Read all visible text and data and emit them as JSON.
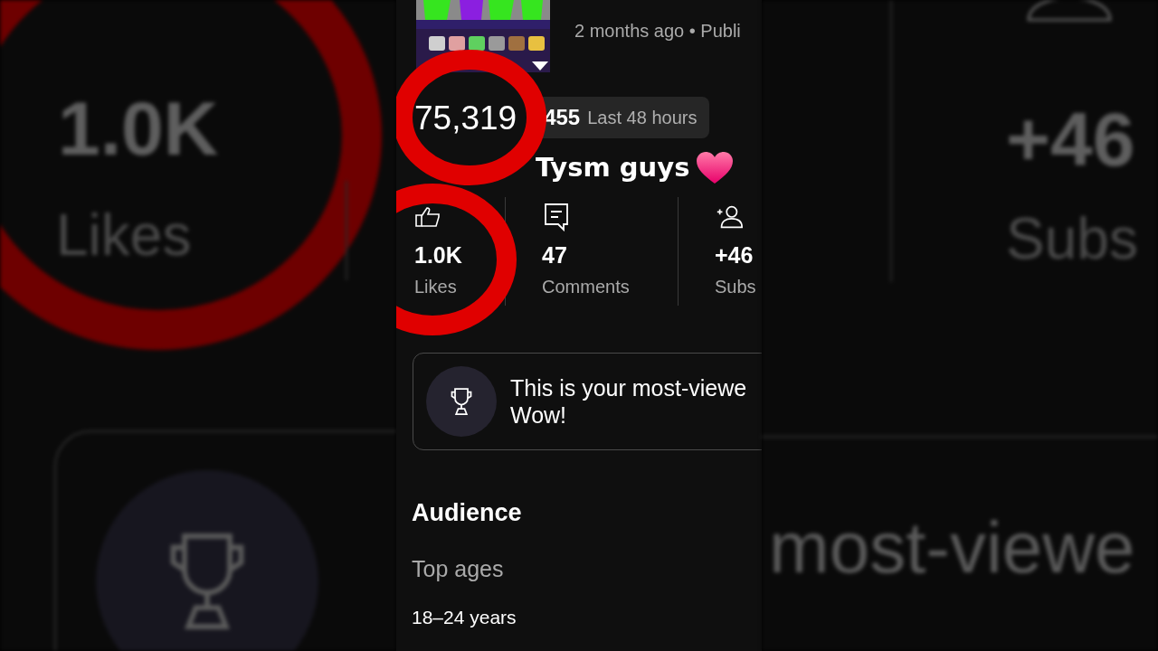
{
  "video": {
    "meta": "2 months ago • Publi",
    "views": "75,319",
    "recent_change": "455",
    "recent_period": "Last 48 hours"
  },
  "caption": "Tysm guys",
  "stats": [
    {
      "kind": "likes",
      "value": "1.0K",
      "label": "Likes"
    },
    {
      "kind": "comments",
      "value": "47",
      "label": "Comments"
    },
    {
      "kind": "subscribers",
      "value": "+46",
      "label": "Subs"
    }
  ],
  "highlight": {
    "lines": [
      "This is your most-viewe",
      "Wow!"
    ]
  },
  "audience": {
    "title": "Audience",
    "subtitle": "Top ages",
    "top_age": "18–24 years"
  },
  "background": {
    "left": [
      "1.0K",
      "Likes"
    ],
    "right": [
      "+46",
      "Subs",
      "most-viewe"
    ]
  }
}
